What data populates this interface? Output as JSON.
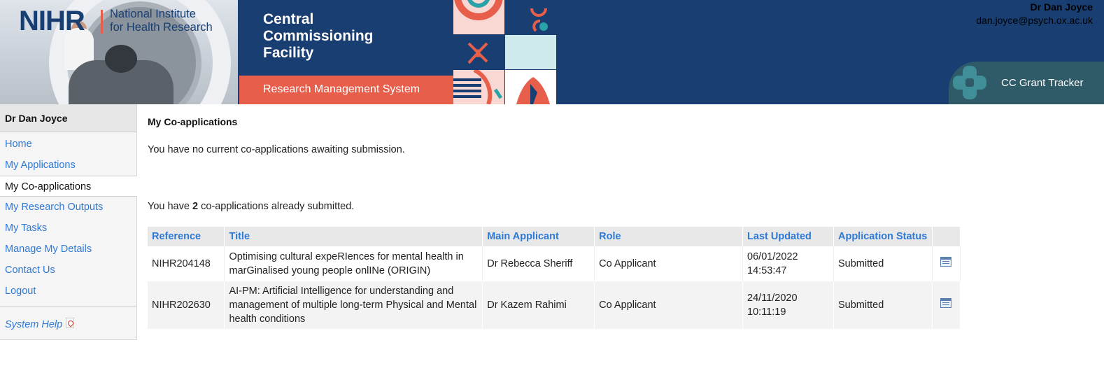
{
  "header": {
    "nihr_mark": "NIHR",
    "nihr_line1": "National Institute",
    "nihr_line2": "for Health Research",
    "ccf_line1": "Central",
    "ccf_line2": "Commissioning",
    "ccf_line3": "Facility",
    "system_name": "Research Management System",
    "user_name": "Dr Dan Joyce",
    "user_email": "dan.joyce@psych.ox.ac.uk",
    "tracker_label": "CC Grant Tracker"
  },
  "sidebar": {
    "user_heading": "Dr Dan Joyce",
    "items": [
      {
        "label": "Home"
      },
      {
        "label": "My Applications"
      },
      {
        "label": "My Co-applications"
      },
      {
        "label": "My Research Outputs"
      },
      {
        "label": "My Tasks"
      },
      {
        "label": "Manage My Details"
      },
      {
        "label": "Contact Us"
      },
      {
        "label": "Logout"
      }
    ],
    "active_index": 2,
    "help_label": "System Help",
    "help_icon": "pdf-icon"
  },
  "main": {
    "title": "My Co-applications",
    "no_current_message": "You have no current co-applications awaiting submission.",
    "submitted_prefix": "You have ",
    "submitted_count": "2",
    "submitted_suffix": " co-applications already submitted.",
    "table": {
      "columns": [
        "Reference",
        "Title",
        "Main Applicant",
        "Role",
        "Last Updated",
        "Application Status",
        ""
      ],
      "rows": [
        {
          "reference": "NIHR204148",
          "title": "Optimising cultural expeRIences for mental health in marGinalised young people onlINe (ORIGIN)",
          "main_applicant": "Dr Rebecca Sheriff",
          "role": "Co Applicant",
          "last_updated_date": "06/01/2022",
          "last_updated_time": "14:53:47",
          "status": "Submitted",
          "action_icon": "view-details-icon"
        },
        {
          "reference": "NIHR202630",
          "title": "AI-PM: Artificial Intelligence for understanding and management of multiple long-term Physical and Mental health conditions",
          "main_applicant": "Dr Kazem Rahimi",
          "role": "Co Applicant",
          "last_updated_date": "24/11/2020",
          "last_updated_time": "10:11:19",
          "status": "Submitted",
          "action_icon": "view-details-icon"
        }
      ]
    }
  },
  "colors": {
    "navy": "#193e72",
    "coral": "#e75e4a",
    "link_blue": "#2f79d6",
    "teal": "#2f5a68"
  }
}
